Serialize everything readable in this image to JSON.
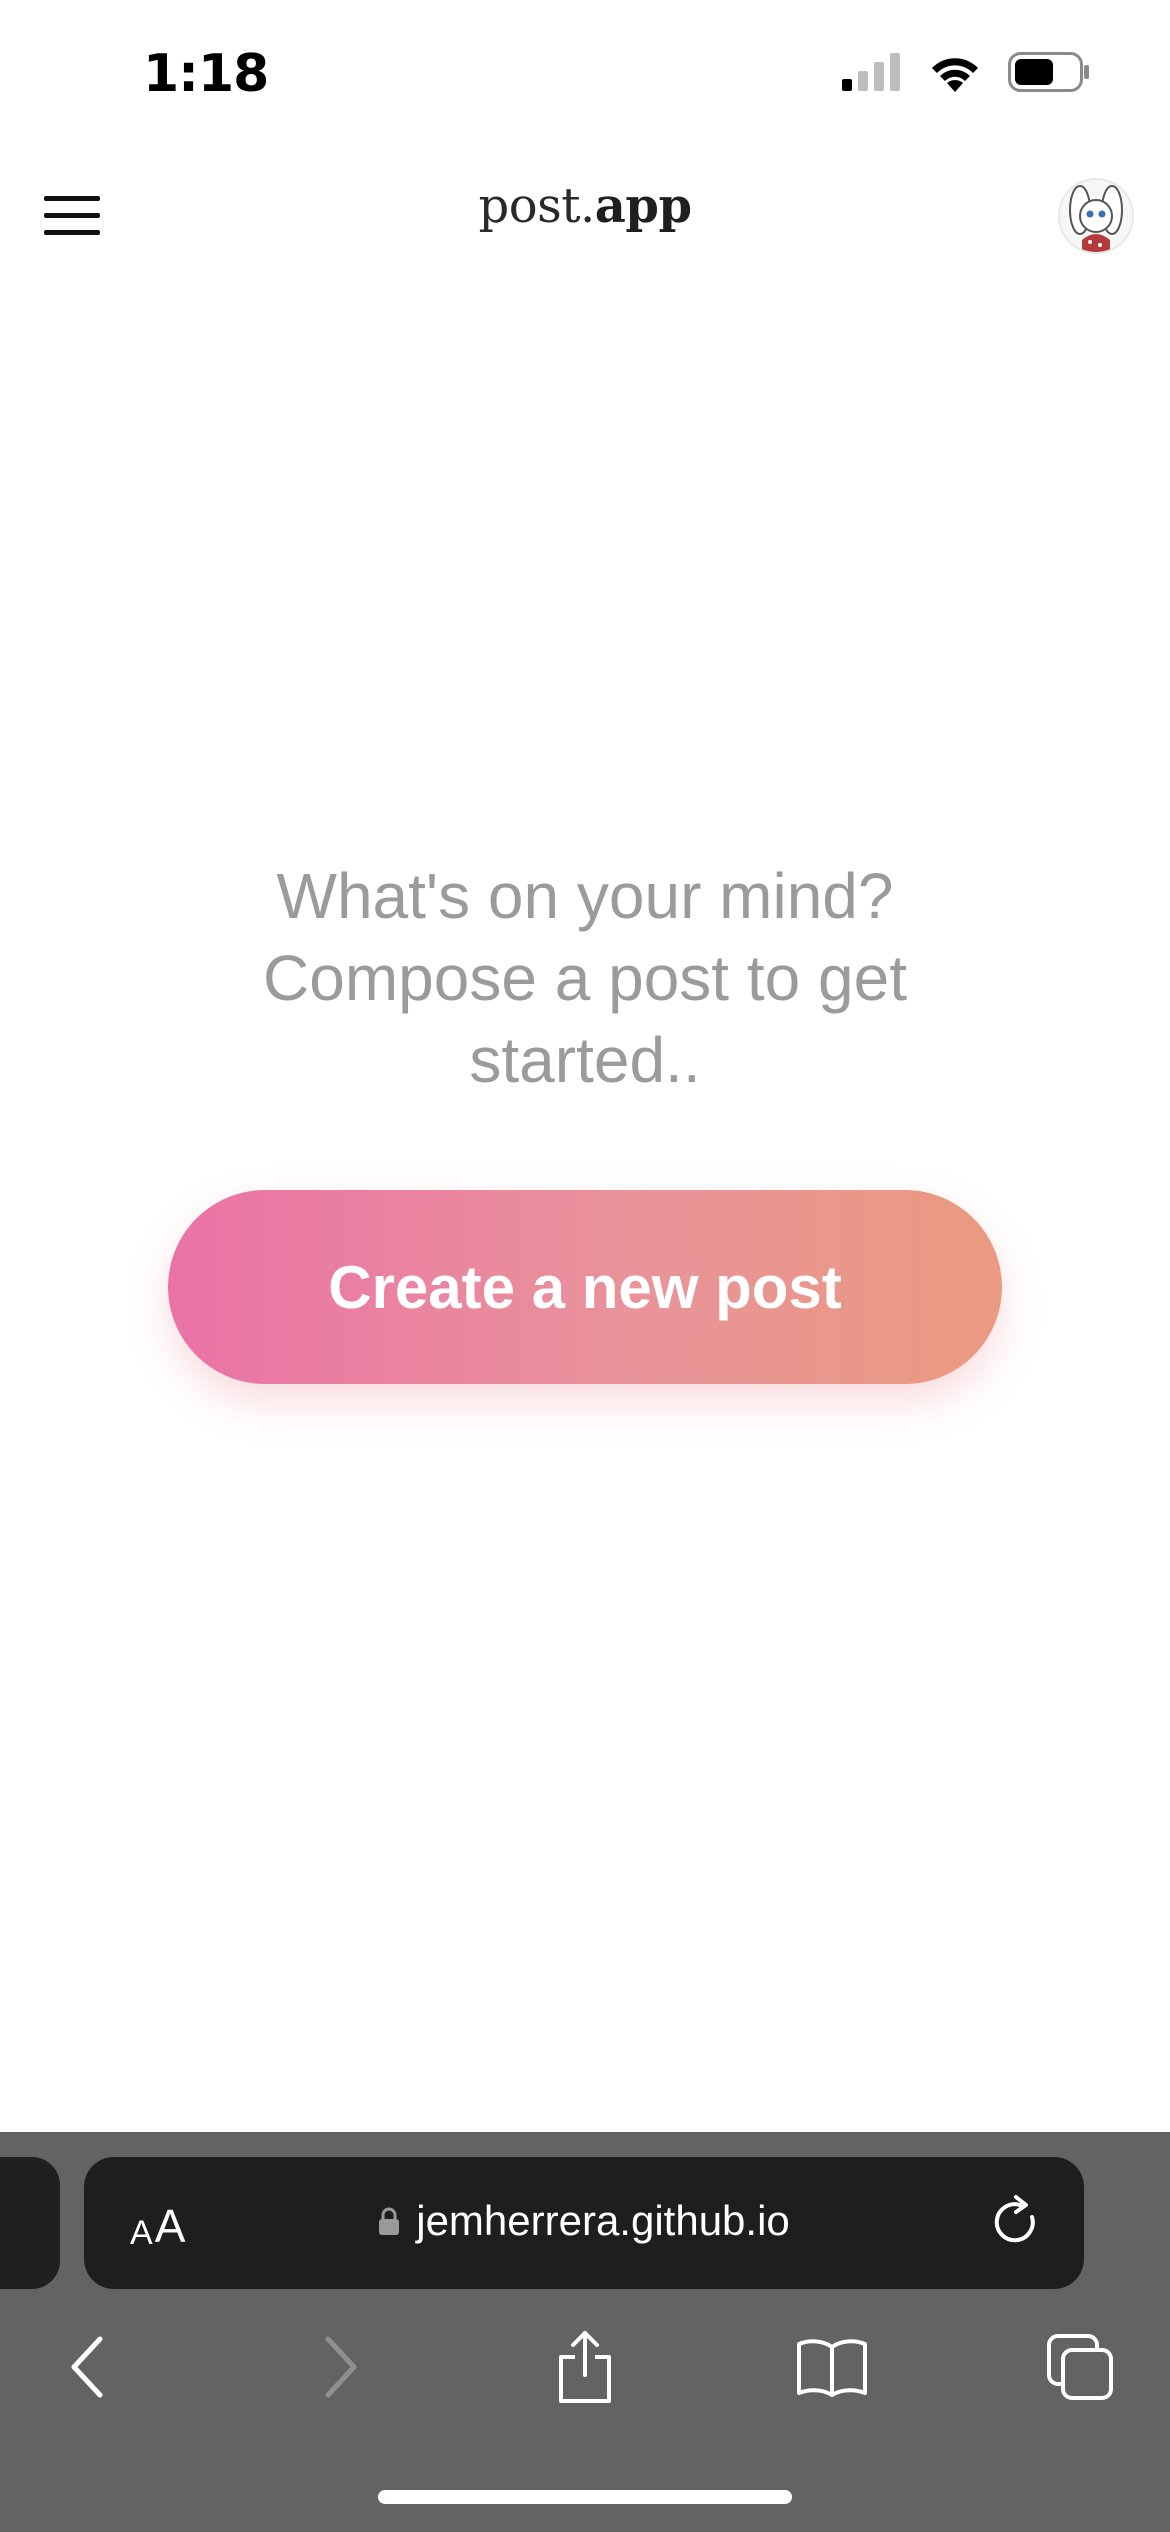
{
  "status_bar": {
    "time": "1:18",
    "icons": [
      "cellular-signal-icon",
      "wifi-icon",
      "battery-icon"
    ]
  },
  "header": {
    "menu_icon": "hamburger-menu-icon",
    "brand_light": "post.",
    "brand_bold": "app",
    "avatar": "user-avatar"
  },
  "empty_state": {
    "message": "What's on your mind? Compose a post to get started..",
    "button_label": "Create a new post"
  },
  "browser": {
    "text_size_small": "A",
    "text_size_large": "A",
    "url": "jemherrera.github.io",
    "toolbar": [
      "back-icon",
      "forward-icon",
      "share-icon",
      "bookmarks-icon",
      "tabs-icon"
    ]
  },
  "colors": {
    "button_gradient_start": "#ea72a6",
    "button_gradient_end": "#ea9a80",
    "message_text": "#9b9b9b",
    "browser_chrome": "#636363",
    "url_field": "#1e1e1e"
  }
}
